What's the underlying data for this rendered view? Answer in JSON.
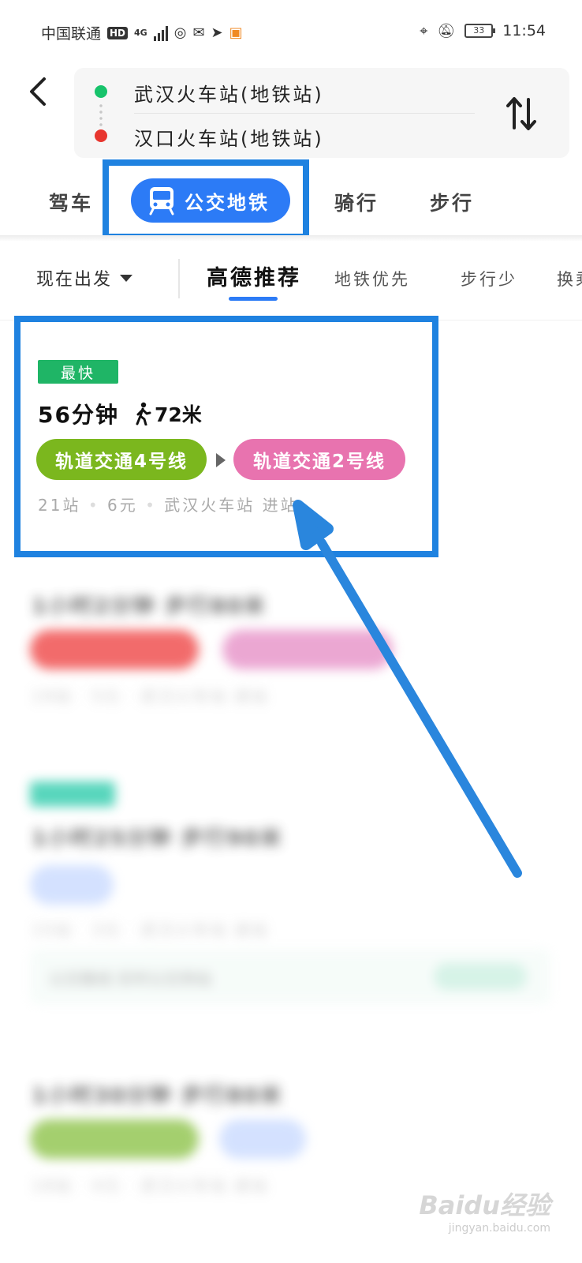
{
  "status_bar": {
    "carrier": "中国联通",
    "hd": "HD",
    "network": "4G",
    "battery": "33",
    "time": "11:54"
  },
  "route": {
    "from": "武汉火车站(地铁站)",
    "to": "汉口火车站(地铁站)"
  },
  "modes": {
    "drive": "驾车",
    "transit": "公交地铁",
    "ride": "骑行",
    "walk": "步行"
  },
  "filters": {
    "depart": "现在出发",
    "options": [
      "高德推荐",
      "地铁优先",
      "步行少",
      "换乘少"
    ],
    "active_index": 0
  },
  "results": [
    {
      "tag": "最快",
      "duration": "56分钟",
      "walk_distance": "72米",
      "lines": [
        {
          "name": "轨道交通4号线",
          "color": "#7bb71e"
        },
        {
          "name": "轨道交通2号线",
          "color": "#e873af"
        }
      ],
      "stops": "21站",
      "fare": "6元",
      "entry": "武汉火车站 进站"
    }
  ],
  "blurred_results": [
    {
      "title": "1小时2分钟 步行80米",
      "meta": "19站 · 5元 · 武汉火车站 进站"
    },
    {
      "title": "1小时25分钟 步行90米",
      "meta": "15站 · 3元 · 武汉火车站 进站",
      "notice": "公交路线 实时公交到站"
    },
    {
      "title": "1小时30分钟 步行80米",
      "meta": "18站 · 4元 · 武汉火车站 进站"
    }
  ],
  "watermark": {
    "brand": "Baidu经验",
    "url": "jingyan.baidu.com"
  },
  "colors": {
    "accent": "#2c7bf6",
    "highlight_box": "#1f82e0",
    "fastest_tag": "#1fb566"
  }
}
